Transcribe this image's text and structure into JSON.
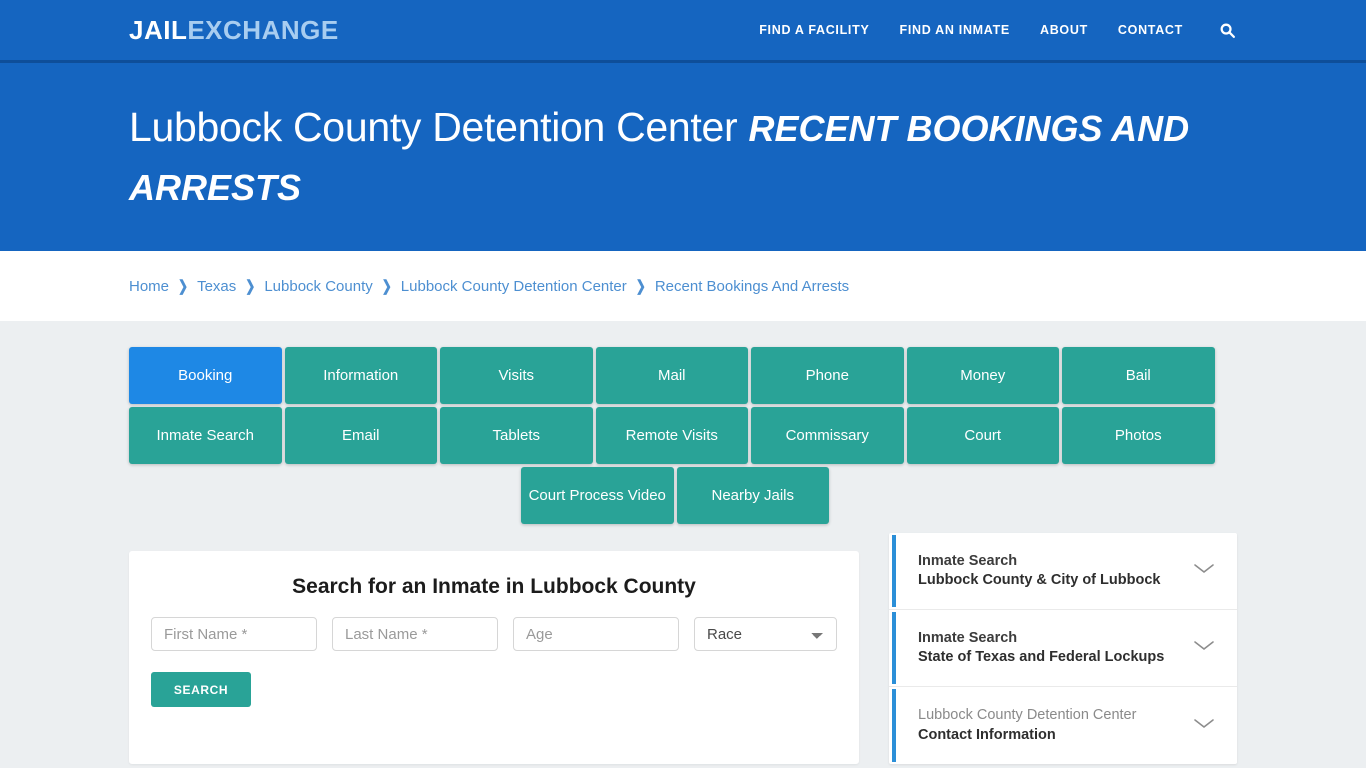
{
  "brand": {
    "part1": "JAIL",
    "part2": "EXCHANGE"
  },
  "nav": {
    "items": [
      {
        "label": "FIND A FACILITY",
        "name": "nav-find-a-facility"
      },
      {
        "label": "FIND AN INMATE",
        "name": "nav-find-an-inmate"
      },
      {
        "label": "ABOUT",
        "name": "nav-about"
      },
      {
        "label": "CONTACT",
        "name": "nav-contact"
      }
    ],
    "search_icon": "search-icon"
  },
  "hero": {
    "facility": "Lubbock County Detention Center",
    "subject": "RECENT BOOKINGS AND ARRESTS"
  },
  "breadcrumb": {
    "separator": "❯",
    "items": [
      "Home",
      "Texas",
      "Lubbock County",
      "Lubbock County Detention Center",
      "Recent Bookings And Arrests"
    ]
  },
  "tiles": {
    "row1": [
      "Booking",
      "Information",
      "Visits",
      "Mail",
      "Phone",
      "Money",
      "Bail"
    ],
    "row2": [
      "Inmate Search",
      "Email",
      "Tablets",
      "Remote Visits",
      "Commissary",
      "Court",
      "Photos"
    ],
    "row3": [
      "Court Process Video",
      "Nearby Jails"
    ],
    "active": "Booking"
  },
  "search": {
    "heading": "Search for an Inmate in Lubbock County",
    "first_name_placeholder": "First Name *",
    "last_name_placeholder": "Last Name *",
    "age_placeholder": "Age",
    "race_selected": "Race",
    "first_name_value": "",
    "last_name_value": "",
    "age_value": "",
    "submit_label": "SEARCH"
  },
  "accordion": {
    "items": [
      {
        "line1": "Inmate Search",
        "line2": "Lubbock County & City of Lubbock",
        "muted": false
      },
      {
        "line1": "Inmate Search",
        "line2": "State of Texas and Federal Lockups",
        "muted": false
      },
      {
        "line1": "Lubbock County Detention Center",
        "line2": "Contact Information",
        "muted": true
      }
    ]
  },
  "colors": {
    "brand_blue": "#1565c0",
    "accent_blue": "#1e88e5",
    "teal": "#29a397",
    "link_blue": "#4d8fd1",
    "page_bg": "#eceff1"
  }
}
